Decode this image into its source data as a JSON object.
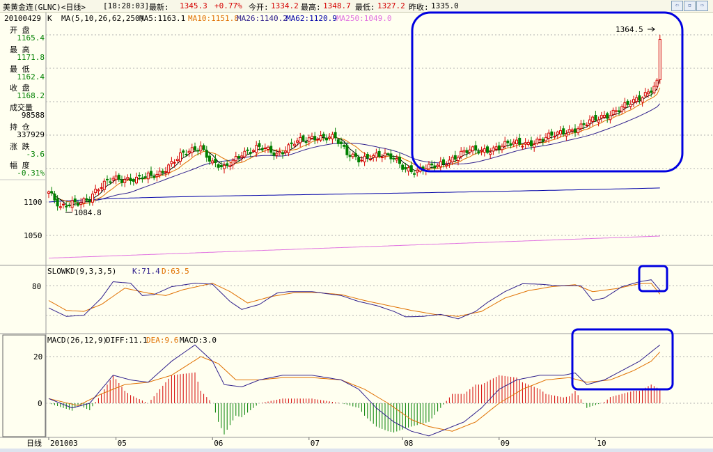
{
  "header": {
    "title": "美黄金连(GLNC)<日线>",
    "time": "[18:28:03]",
    "last_label": "最新:",
    "last_value": "1345.3",
    "change": "+0.77%",
    "open_label": "今开:",
    "open_value": "1334.2",
    "high_label": "最高:",
    "high_value": "1348.7",
    "low_label": "最低:",
    "low_value": "1327.2",
    "prev_label": "昨收:",
    "prev_value": "1335.0"
  },
  "info_panel": {
    "date": "20100429",
    "rows": [
      {
        "label": "开 盘",
        "value": "1165.4"
      },
      {
        "label": "最 高",
        "value": "1171.8"
      },
      {
        "label": "最 低",
        "value": "1162.4"
      },
      {
        "label": "收 盘",
        "value": "1168.2"
      },
      {
        "label": "成交量",
        "value": "98588"
      },
      {
        "label": "持 仓",
        "value": "337929"
      },
      {
        "label": "涨 跌",
        "value": "-3.6"
      },
      {
        "label": "幅 度",
        "value": "-0.31%"
      }
    ]
  },
  "colors": {
    "background": "#fffff0",
    "up": "#d40000",
    "down": "#008000",
    "ma5": "#000000",
    "ma10": "#e07000",
    "ma26": "#30208c",
    "ma62": "#0000a8",
    "ma250": "#e070e0",
    "highlight": "#0000e0"
  },
  "chart_data": [
    {
      "type": "candlestick",
      "legend": {
        "code": "K",
        "ma_params": "MA(5,10,26,62,250)",
        "ma5": "MA5:1163.1",
        "ma10": "MA10:1151.8",
        "ma26": "MA26:1140.2",
        "ma62": "MA62:1120.9",
        "ma250": "MA250:1049.0"
      },
      "y_ticks": [
        1050,
        1100
      ],
      "annotations": [
        "1084.8",
        "1364.5"
      ],
      "trend_close": [
        [
          0,
          1115
        ],
        [
          4,
          1088
        ],
        [
          8,
          1100
        ],
        [
          14,
          1105
        ],
        [
          22,
          1138
        ],
        [
          30,
          1132
        ],
        [
          38,
          1145
        ],
        [
          46,
          1170
        ],
        [
          52,
          1185
        ],
        [
          56,
          1158
        ],
        [
          60,
          1148
        ],
        [
          66,
          1175
        ],
        [
          72,
          1180
        ],
        [
          78,
          1172
        ],
        [
          84,
          1190
        ],
        [
          88,
          1190
        ],
        [
          92,
          1198
        ],
        [
          96,
          1200
        ],
        [
          98,
          1196
        ],
        [
          102,
          1170
        ],
        [
          106,
          1165
        ],
        [
          110,
          1170
        ],
        [
          114,
          1168
        ],
        [
          118,
          1165
        ],
        [
          122,
          1152
        ],
        [
          126,
          1145
        ],
        [
          130,
          1150
        ],
        [
          136,
          1162
        ],
        [
          144,
          1176
        ],
        [
          152,
          1180
        ],
        [
          160,
          1188
        ],
        [
          166,
          1190
        ],
        [
          170,
          1194
        ],
        [
          176,
          1206
        ],
        [
          182,
          1212
        ],
        [
          188,
          1225
        ],
        [
          194,
          1238
        ],
        [
          200,
          1248
        ],
        [
          204,
          1262
        ],
        [
          208,
          1280
        ],
        [
          209,
          1345
        ]
      ],
      "ma250": [
        1016,
        1049
      ],
      "ma62_end": 1120.9,
      "ma26_end": 1140.2
    },
    {
      "type": "line",
      "title": "SLOWKD(9,3,3,5)",
      "series": [
        {
          "name": "K",
          "last": "K:71.4"
        },
        {
          "name": "D",
          "last": "D:63.5"
        }
      ],
      "y_ticks": [
        80
      ],
      "k_trend": [
        [
          0,
          35
        ],
        [
          6,
          18
        ],
        [
          12,
          20
        ],
        [
          18,
          55
        ],
        [
          22,
          88
        ],
        [
          28,
          85
        ],
        [
          32,
          60
        ],
        [
          36,
          62
        ],
        [
          42,
          78
        ],
        [
          50,
          85
        ],
        [
          56,
          83
        ],
        [
          62,
          48
        ],
        [
          66,
          32
        ],
        [
          72,
          42
        ],
        [
          78,
          65
        ],
        [
          82,
          68
        ],
        [
          90,
          68
        ],
        [
          100,
          60
        ],
        [
          106,
          48
        ],
        [
          112,
          40
        ],
        [
          118,
          28
        ],
        [
          122,
          17
        ],
        [
          128,
          18
        ],
        [
          134,
          22
        ],
        [
          140,
          13
        ],
        [
          146,
          28
        ],
        [
          150,
          46
        ],
        [
          156,
          68
        ],
        [
          162,
          84
        ],
        [
          168,
          83
        ],
        [
          174,
          80
        ],
        [
          178,
          80
        ],
        [
          182,
          80
        ],
        [
          186,
          50
        ],
        [
          190,
          55
        ],
        [
          196,
          78
        ],
        [
          202,
          88
        ],
        [
          206,
          92
        ],
        [
          209,
          71
        ]
      ],
      "d_trend": [
        [
          0,
          50
        ],
        [
          6,
          30
        ],
        [
          12,
          28
        ],
        [
          18,
          42
        ],
        [
          26,
          75
        ],
        [
          34,
          65
        ],
        [
          40,
          60
        ],
        [
          46,
          72
        ],
        [
          56,
          85
        ],
        [
          62,
          68
        ],
        [
          68,
          45
        ],
        [
          76,
          58
        ],
        [
          84,
          66
        ],
        [
          92,
          66
        ],
        [
          100,
          62
        ],
        [
          108,
          50
        ],
        [
          116,
          40
        ],
        [
          124,
          30
        ],
        [
          132,
          22
        ],
        [
          140,
          18
        ],
        [
          148,
          28
        ],
        [
          156,
          55
        ],
        [
          164,
          70
        ],
        [
          172,
          78
        ],
        [
          180,
          82
        ],
        [
          186,
          68
        ],
        [
          194,
          74
        ],
        [
          202,
          84
        ],
        [
          206,
          85
        ],
        [
          209,
          63
        ]
      ]
    },
    {
      "type": "line",
      "title": "MACD(26,12,9)",
      "series": [
        {
          "name": "DIFF",
          "last": "DIFF:11.1"
        },
        {
          "name": "DEA",
          "last": "DEA:9.6"
        },
        {
          "name": "MACD",
          "last": "MACD:3.0"
        }
      ],
      "y_ticks": [
        0,
        20
      ],
      "diff_trend": [
        [
          0,
          2
        ],
        [
          8,
          -2
        ],
        [
          14,
          0
        ],
        [
          22,
          12
        ],
        [
          28,
          10
        ],
        [
          34,
          9
        ],
        [
          42,
          18
        ],
        [
          50,
          25
        ],
        [
          56,
          18
        ],
        [
          60,
          8
        ],
        [
          66,
          7
        ],
        [
          72,
          10
        ],
        [
          80,
          12
        ],
        [
          90,
          12
        ],
        [
          100,
          10
        ],
        [
          106,
          6
        ],
        [
          112,
          -2
        ],
        [
          118,
          -8
        ],
        [
          124,
          -12
        ],
        [
          130,
          -14
        ],
        [
          136,
          -11
        ],
        [
          142,
          -8
        ],
        [
          148,
          -2
        ],
        [
          154,
          6
        ],
        [
          160,
          10
        ],
        [
          168,
          12
        ],
        [
          176,
          12
        ],
        [
          180,
          13
        ],
        [
          184,
          8
        ],
        [
          190,
          10
        ],
        [
          196,
          14
        ],
        [
          202,
          18
        ],
        [
          206,
          22
        ],
        [
          209,
          25
        ]
      ],
      "dea_trend": [
        [
          0,
          2
        ],
        [
          10,
          -1
        ],
        [
          18,
          4
        ],
        [
          26,
          8
        ],
        [
          34,
          9
        ],
        [
          42,
          12
        ],
        [
          52,
          20
        ],
        [
          58,
          17
        ],
        [
          64,
          10
        ],
        [
          72,
          10
        ],
        [
          80,
          11
        ],
        [
          90,
          11
        ],
        [
          100,
          10
        ],
        [
          108,
          6
        ],
        [
          116,
          0
        ],
        [
          124,
          -7
        ],
        [
          130,
          -10
        ],
        [
          138,
          -12
        ],
        [
          146,
          -8
        ],
        [
          154,
          0
        ],
        [
          162,
          6
        ],
        [
          170,
          10
        ],
        [
          178,
          11
        ],
        [
          184,
          9
        ],
        [
          192,
          10
        ],
        [
          200,
          14
        ],
        [
          206,
          18
        ],
        [
          209,
          22
        ]
      ]
    }
  ],
  "x_axis": {
    "period_label": "日线",
    "labels": [
      {
        "index": 0,
        "text": "201003"
      },
      {
        "index": 23,
        "text": "05"
      },
      {
        "index": 56,
        "text": "06"
      },
      {
        "index": 89,
        "text": "07"
      },
      {
        "index": 121,
        "text": "08"
      },
      {
        "index": 154,
        "text": "09"
      },
      {
        "index": 187,
        "text": "10"
      }
    ]
  }
}
